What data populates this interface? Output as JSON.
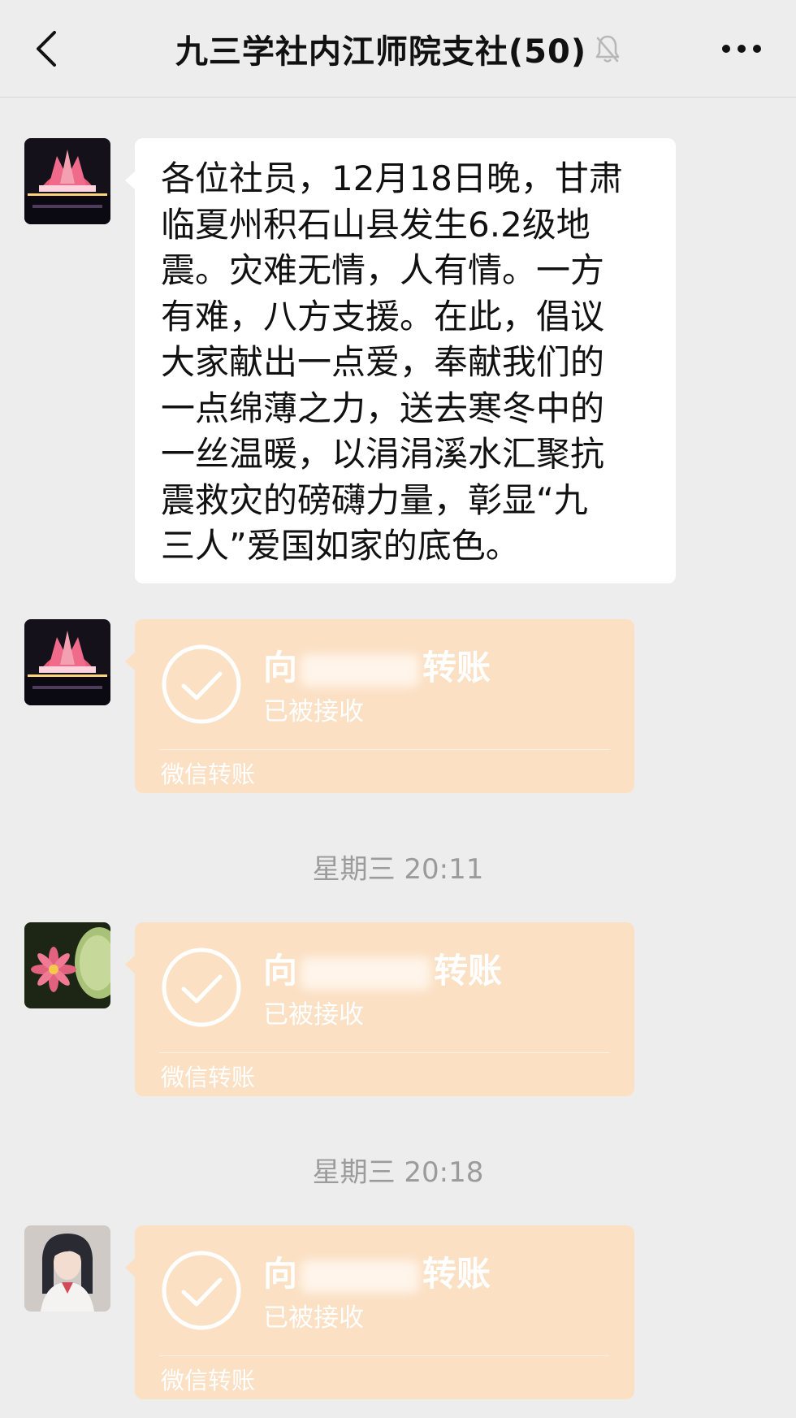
{
  "header": {
    "title": "九三学社内江师院支社(50)",
    "back_icon": "chevron-left-icon",
    "mute_icon": "bell-muted-icon",
    "more_icon": "more-dots-icon"
  },
  "messages": {
    "announcement": {
      "lines": [
        "各位社员，12月18日晚，甘肃",
        "临夏州积石山县发生6.2级地",
        "震。灾难无情，人有情。一方",
        "有难，八方支援。在此，倡议",
        "大家献出一点爱，奉献我们的",
        "一点绵薄之力，送去寒冬中的",
        "一丝温暖，以涓涓溪水汇聚抗",
        "震救灾的磅礴力量，彰显“九",
        "三人”爱国如家的底色。"
      ]
    },
    "transfers": [
      {
        "prefix": "向",
        "suffix": "转账",
        "status": "已被接收",
        "footer": "微信转账"
      },
      {
        "prefix": "向",
        "suffix": "转账",
        "status": "已被接收",
        "footer": "微信转账"
      },
      {
        "prefix": "向",
        "suffix": "转账",
        "status": "已被接收",
        "footer": "微信转账"
      }
    ],
    "timestamps": [
      "星期三 20:11",
      "星期三 20:18"
    ]
  },
  "colors": {
    "background": "#ededed",
    "bubble": "#ffffff",
    "transfer": "#fbe0c4",
    "timestamp": "#9b9b9b"
  }
}
